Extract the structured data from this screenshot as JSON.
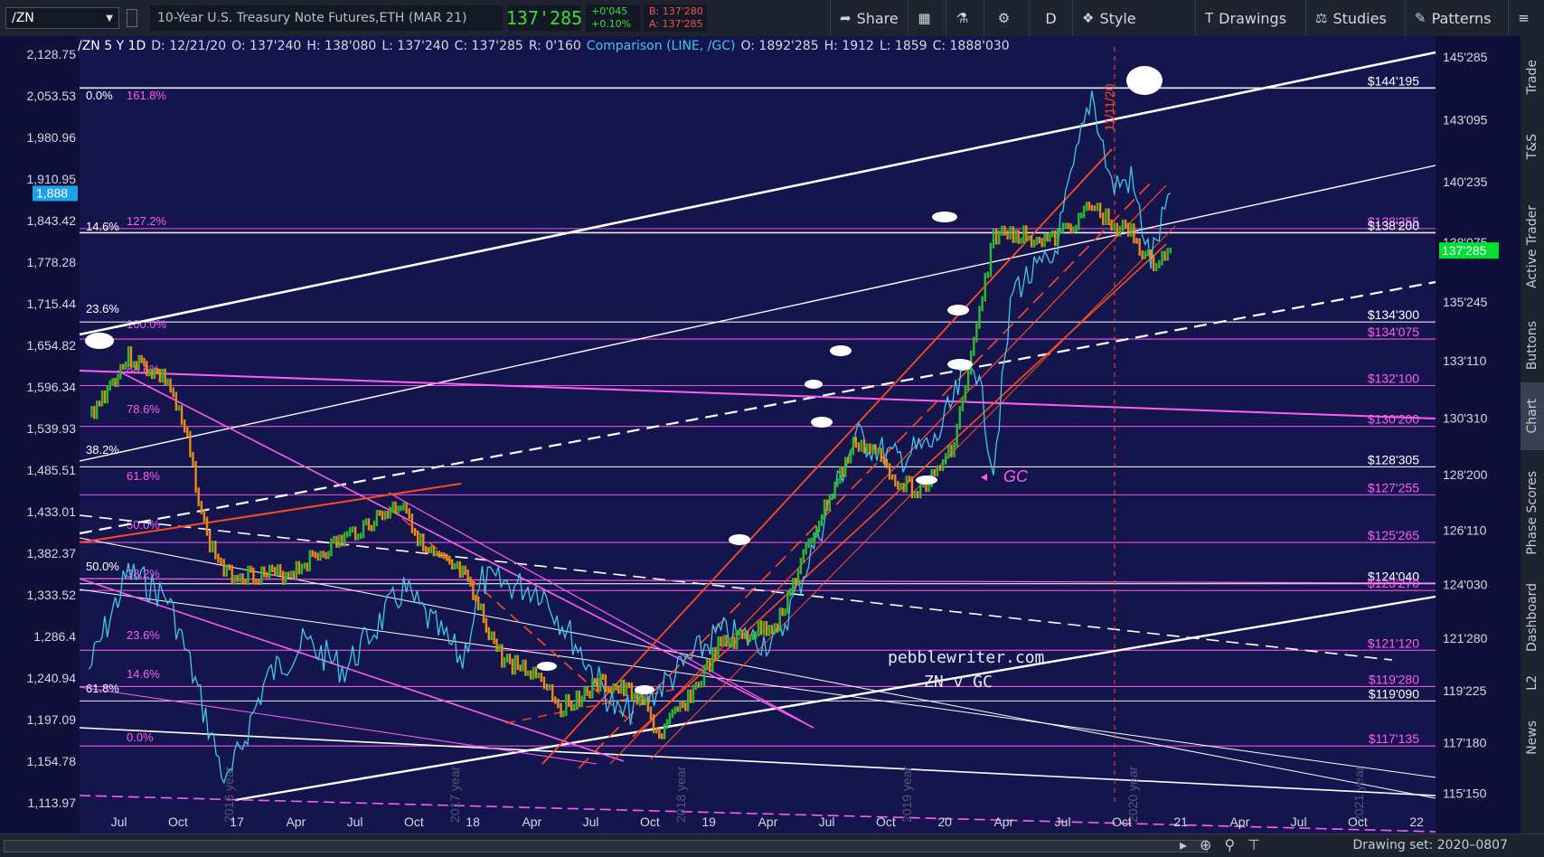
{
  "toolbar": {
    "symbol": "/ZN",
    "instrument": "10-Year U.S. Treasury Note Futures,ETH (MAR 21)",
    "last": "137'285",
    "change": "+0'045",
    "change_pct": "+0.10%",
    "bid": "B: 137'280",
    "ask": "A: 137'285",
    "share": "Share",
    "timeframe": "D",
    "style": "Style",
    "drawings": "Drawings",
    "studies": "Studies",
    "patterns": "Patterns"
  },
  "header": {
    "symbol_tf": "/ZN 5 Y 1D",
    "date": "D: 12/21/20",
    "open": "O: 137'240",
    "high": "H: 138'080",
    "low": "L: 137'240",
    "close": "C: 137'285",
    "range": "R: 0'160",
    "comparison": "Comparison (LINE, /GC)",
    "cmp_open": "O: 1892'285",
    "cmp_high": "H: 1912",
    "cmp_low": "L: 1859",
    "cmp_close": "C: 1888'030"
  },
  "right_tabs": [
    "Trade",
    "T&S",
    "Active Trader",
    "Buttons",
    "Chart",
    "Phase Scores",
    "Dashboard",
    "L2",
    "News"
  ],
  "bottom": {
    "drawing_set": "Drawing set: 2020–0807"
  },
  "colors": {
    "background": "#15154e",
    "zn_up": "#2fb82f",
    "zn_down": "#e88a1a",
    "gc_line": "#3fc8e8",
    "channel": "#ff4a20",
    "fib_white": "#ffffff",
    "fib_magenta": "#ff5cf0",
    "price_label": "#00dd33"
  },
  "chart_data": {
    "type": "line",
    "title": "",
    "xlabel": "",
    "ylabel": "",
    "x_ticks": [
      "Jul",
      "Oct",
      "17",
      "Apr",
      "Jul",
      "Oct",
      "18",
      "Apr",
      "Jul",
      "Oct",
      "19",
      "Apr",
      "Jul",
      "Oct",
      "20",
      "Apr",
      "Jul",
      "Oct",
      "21",
      "Apr",
      "Jul",
      "Oct",
      "22"
    ],
    "y_left_ticks": [
      "2,128.75",
      "2,053.53",
      "1,980.96",
      "1,910.95",
      "1,843.42",
      "1,778.28",
      "1,715.44",
      "1,654.82",
      "1,596.34",
      "1,539.93",
      "1,485.51",
      "1,433.01",
      "1,382.37",
      "1,333.52",
      "1,286.4",
      "1,240.94",
      "1,197.09",
      "1,154.78",
      "1,113.97"
    ],
    "y_right_ticks": [
      "145'285",
      "143'095",
      "140'235",
      "138'075",
      "135'245",
      "133'110",
      "130'310",
      "128'200",
      "126'110",
      "124'030",
      "121'280",
      "119'225",
      "117'180",
      "115'150"
    ],
    "gc_last_label": "1,888",
    "zn_last_label": "137'285",
    "series": [
      {
        "name": "/ZN",
        "points": [
          [
            "2016-05",
            131.0
          ],
          [
            "2016-07",
            133.5
          ],
          [
            "2016-09",
            132.5
          ],
          [
            "2016-10",
            130.0
          ],
          [
            "2016-11",
            126.0
          ],
          [
            "2016-12",
            124.5
          ],
          [
            "2017-03",
            124.5
          ],
          [
            "2017-06",
            126.0
          ],
          [
            "2017-09",
            127.5
          ],
          [
            "2017-10",
            125.5
          ],
          [
            "2017-12",
            124.5
          ],
          [
            "2018-02",
            121.0
          ],
          [
            "2018-04",
            120.3
          ],
          [
            "2018-05",
            119.0
          ],
          [
            "2018-07",
            120.0
          ],
          [
            "2018-09",
            119.5
          ],
          [
            "2018-10",
            117.8
          ],
          [
            "2018-12",
            120.0
          ],
          [
            "2019-01",
            121.5
          ],
          [
            "2019-04",
            122.5
          ],
          [
            "2019-06",
            126.5
          ],
          [
            "2019-08",
            130.0
          ],
          [
            "2019-09",
            129.5
          ],
          [
            "2019-10",
            128.5
          ],
          [
            "2019-11",
            128.0
          ],
          [
            "2019-12",
            128.5
          ],
          [
            "2020-01",
            130.0
          ],
          [
            "2020-02",
            134.0
          ],
          [
            "2020-03",
            138.5
          ],
          [
            "2020-04",
            138.6
          ],
          [
            "2020-06",
            138.3
          ],
          [
            "2020-08",
            139.7
          ],
          [
            "2020-09",
            139.0
          ],
          [
            "2020-10",
            138.6
          ],
          [
            "2020-11",
            137.3
          ],
          [
            "2020-12",
            137.9
          ]
        ]
      },
      {
        "name": "/GC",
        "points": [
          [
            "2016-05",
            1250
          ],
          [
            "2016-07",
            1360
          ],
          [
            "2016-09",
            1330
          ],
          [
            "2016-10",
            1265
          ],
          [
            "2016-12",
            1130
          ],
          [
            "2017-02",
            1240
          ],
          [
            "2017-04",
            1280
          ],
          [
            "2017-06",
            1250
          ],
          [
            "2017-09",
            1340
          ],
          [
            "2017-12",
            1260
          ],
          [
            "2018-01",
            1350
          ],
          [
            "2018-04",
            1340
          ],
          [
            "2018-06",
            1270
          ],
          [
            "2018-08",
            1200
          ],
          [
            "2018-10",
            1230
          ],
          [
            "2019-01",
            1290
          ],
          [
            "2019-04",
            1280
          ],
          [
            "2019-06",
            1400
          ],
          [
            "2019-08",
            1530
          ],
          [
            "2019-10",
            1500
          ],
          [
            "2019-12",
            1520
          ],
          [
            "2020-02",
            1640
          ],
          [
            "2020-03",
            1490
          ],
          [
            "2020-04",
            1740
          ],
          [
            "2020-06",
            1780
          ],
          [
            "2020-08",
            2060
          ],
          [
            "2020-09",
            1900
          ],
          [
            "2020-10",
            1910
          ],
          [
            "2020-11",
            1780
          ],
          [
            "2020-12",
            1888
          ]
        ]
      }
    ],
    "right_levels": [
      {
        "label": "$144'195",
        "color": "#ffffff"
      },
      {
        "label": "$138'255",
        "color": "#ff5cf0"
      },
      {
        "label": "$138'200",
        "color": "#ffffff"
      },
      {
        "label": "$134'300",
        "color": "#ffffff"
      },
      {
        "label": "$134'075",
        "color": "#ff5cf0"
      },
      {
        "label": "$132'100",
        "color": "#ff5cf0"
      },
      {
        "label": "$130'200",
        "color": "#ff5cf0"
      },
      {
        "label": "$128'305",
        "color": "#ffffff"
      },
      {
        "label": "$127'255",
        "color": "#ff5cf0"
      },
      {
        "label": "$125'265",
        "color": "#ff5cf0"
      },
      {
        "label": "$124'040",
        "color": "#ffffff"
      },
      {
        "label": "$123'270",
        "color": "#ff5cf0"
      },
      {
        "label": "$121'120",
        "color": "#ff5cf0"
      },
      {
        "label": "$119'280",
        "color": "#ff5cf0"
      },
      {
        "label": "$119'090",
        "color": "#ffffff"
      },
      {
        "label": "$117'135",
        "color": "#ff5cf0"
      }
    ],
    "left_levels": [
      {
        "label": "0.0%",
        "color": "#ffffff"
      },
      {
        "label": "161.8%",
        "color": "#ff5cf0"
      },
      {
        "label": "14.6%",
        "color": "#ffffff"
      },
      {
        "label": "127.2%",
        "color": "#ff5cf0"
      },
      {
        "label": "23.6%",
        "color": "#ffffff"
      },
      {
        "label": "100.0%",
        "color": "#ff5cf0"
      },
      {
        "label": "88.6%",
        "color": "#ff5cf0"
      },
      {
        "label": "78.6%",
        "color": "#ff5cf0"
      },
      {
        "label": "38.2%",
        "color": "#ffffff"
      },
      {
        "label": "61.8%",
        "color": "#ff5cf0"
      },
      {
        "label": "50.0%",
        "color": "#ff5cf0"
      },
      {
        "label": "50.0%",
        "color": "#ffffff"
      },
      {
        "label": "38.2%",
        "color": "#ff5cf0"
      },
      {
        "label": "23.6%",
        "color": "#ff5cf0"
      },
      {
        "label": "14.6%",
        "color": "#ff5cf0"
      },
      {
        "label": "61.8%",
        "color": "#ffffff"
      },
      {
        "label": "0.0%",
        "color": "#ff5cf0"
      }
    ],
    "annotations": {
      "gc_tag": "GC",
      "date_mark": "11/11/20",
      "watermark_line1": "pebblewriter.com",
      "watermark_line2": "ZN v GC",
      "year_labels": [
        "2016 year",
        "2017 year",
        "2018 year",
        "2019 year",
        "2020 year",
        "2021 year"
      ]
    },
    "grid": false
  }
}
